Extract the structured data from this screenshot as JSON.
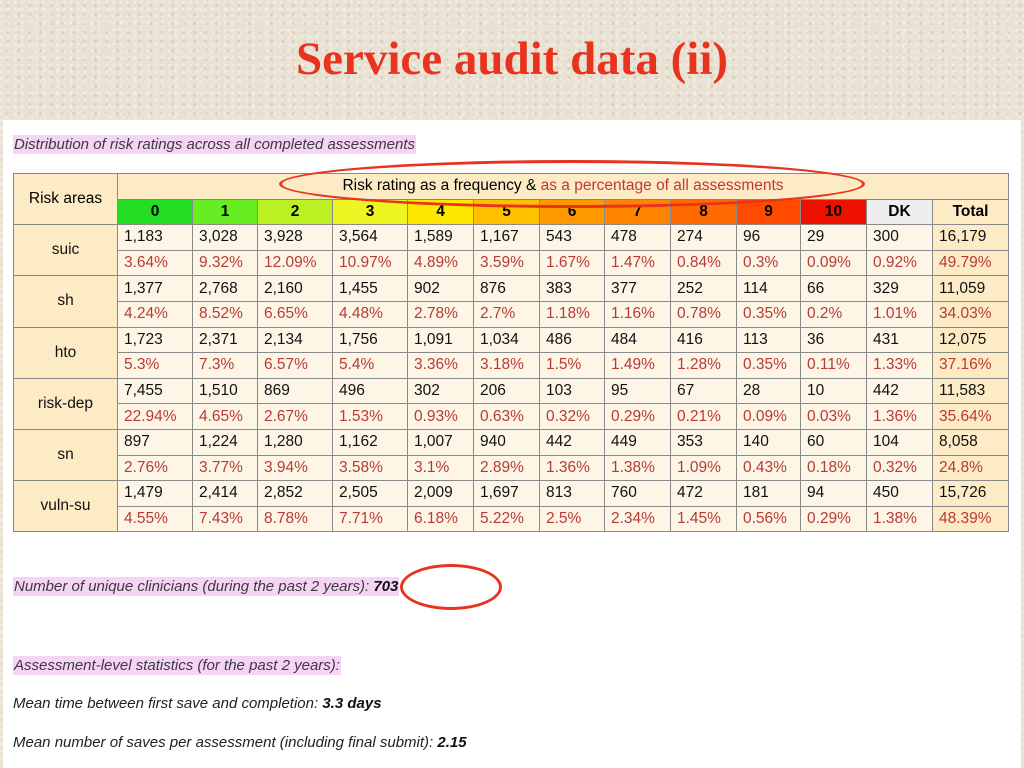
{
  "title": "Service audit data (ii)",
  "caption": "Distribution of risk ratings across all completed assessments",
  "table": {
    "risk_areas_label": "Risk areas",
    "header_prefix": "Risk rating as a frequency & ",
    "header_suffix": "as a percentage of all assessments",
    "ratings": [
      {
        "label": "0",
        "color": "#22dd22"
      },
      {
        "label": "1",
        "color": "#66ee22"
      },
      {
        "label": "2",
        "color": "#bbf022"
      },
      {
        "label": "3",
        "color": "#ecf422"
      },
      {
        "label": "4",
        "color": "#ffe800"
      },
      {
        "label": "5",
        "color": "#ffc000"
      },
      {
        "label": "6",
        "color": "#ff9900"
      },
      {
        "label": "7",
        "color": "#ff8400"
      },
      {
        "label": "8",
        "color": "#ff6a00"
      },
      {
        "label": "9",
        "color": "#ff4a00"
      },
      {
        "label": "10",
        "color": "#ee1100"
      },
      {
        "label": "DK",
        "color": "#eeeeee"
      },
      {
        "label": "Total",
        "color": "#fdebc6"
      }
    ],
    "rows": [
      {
        "area": "suic",
        "counts": [
          "1,183",
          "3,028",
          "3,928",
          "3,564",
          "1,589",
          "1,167",
          "543",
          "478",
          "274",
          "96",
          "29",
          "300",
          "16,179"
        ],
        "percents": [
          "3.64%",
          "9.32%",
          "12.09%",
          "10.97%",
          "4.89%",
          "3.59%",
          "1.67%",
          "1.47%",
          "0.84%",
          "0.3%",
          "0.09%",
          "0.92%",
          "49.79%"
        ]
      },
      {
        "area": "sh",
        "counts": [
          "1,377",
          "2,768",
          "2,160",
          "1,455",
          "902",
          "876",
          "383",
          "377",
          "252",
          "114",
          "66",
          "329",
          "11,059"
        ],
        "percents": [
          "4.24%",
          "8.52%",
          "6.65%",
          "4.48%",
          "2.78%",
          "2.7%",
          "1.18%",
          "1.16%",
          "0.78%",
          "0.35%",
          "0.2%",
          "1.01%",
          "34.03%"
        ]
      },
      {
        "area": "hto",
        "counts": [
          "1,723",
          "2,371",
          "2,134",
          "1,756",
          "1,091",
          "1,034",
          "486",
          "484",
          "416",
          "113",
          "36",
          "431",
          "12,075"
        ],
        "percents": [
          "5.3%",
          "7.3%",
          "6.57%",
          "5.4%",
          "3.36%",
          "3.18%",
          "1.5%",
          "1.49%",
          "1.28%",
          "0.35%",
          "0.11%",
          "1.33%",
          "37.16%"
        ]
      },
      {
        "area": "risk-dep",
        "counts": [
          "7,455",
          "1,510",
          "869",
          "496",
          "302",
          "206",
          "103",
          "95",
          "67",
          "28",
          "10",
          "442",
          "11,583"
        ],
        "percents": [
          "22.94%",
          "4.65%",
          "2.67%",
          "1.53%",
          "0.93%",
          "0.63%",
          "0.32%",
          "0.29%",
          "0.21%",
          "0.09%",
          "0.03%",
          "1.36%",
          "35.64%"
        ]
      },
      {
        "area": "sn",
        "counts": [
          "897",
          "1,224",
          "1,280",
          "1,162",
          "1,007",
          "940",
          "442",
          "449",
          "353",
          "140",
          "60",
          "104",
          "8,058"
        ],
        "percents": [
          "2.76%",
          "3.77%",
          "3.94%",
          "3.58%",
          "3.1%",
          "2.89%",
          "1.36%",
          "1.38%",
          "1.09%",
          "0.43%",
          "0.18%",
          "0.32%",
          "24.8%"
        ]
      },
      {
        "area": "vuln-su",
        "counts": [
          "1,479",
          "2,414",
          "2,852",
          "2,505",
          "2,009",
          "1,697",
          "813",
          "760",
          "472",
          "181",
          "94",
          "450",
          "15,726"
        ],
        "percents": [
          "4.55%",
          "7.43%",
          "8.78%",
          "7.71%",
          "6.18%",
          "5.22%",
          "2.5%",
          "2.34%",
          "1.45%",
          "0.56%",
          "0.29%",
          "1.38%",
          "48.39%"
        ]
      }
    ]
  },
  "clinicians": {
    "label": "Number of unique clinicians (during the past 2 years): ",
    "value": "703"
  },
  "stats": {
    "heading": "Assessment-level statistics (for the past 2 years):",
    "mean_time_label": "Mean time between first save and completion: ",
    "mean_time_value": "3.3 days",
    "mean_saves_label": "Mean number of saves per assessment (including final submit): ",
    "mean_saves_value": "2.15"
  },
  "annotation_color": "#e8331f"
}
